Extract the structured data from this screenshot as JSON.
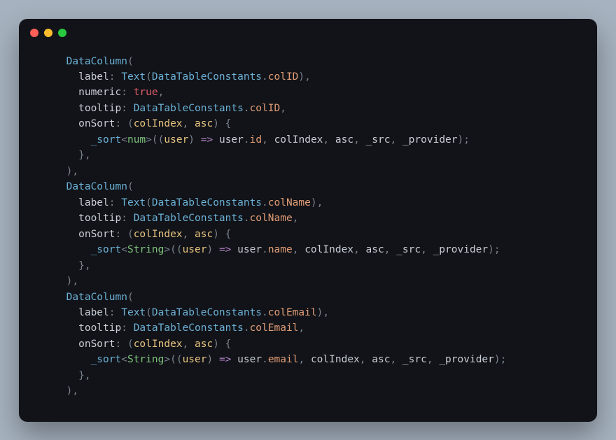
{
  "lang": "dart",
  "titlebar": {
    "close": "close",
    "minimize": "minimize",
    "zoom": "zoom"
  },
  "indent": {
    "d1": "     ",
    "d2": "       ",
    "d3": "         "
  },
  "tokens": {
    "DataColumn": "DataColumn",
    "Text": "Text",
    "DataTableConstants": "DataTableConstants",
    "label": "label",
    "numeric": "numeric",
    "tooltip": "tooltip",
    "onSort": "onSort",
    "true": "true",
    "colID": "colID",
    "colName": "colName",
    "colEmail": "colEmail",
    "colIndex": "colIndex",
    "asc": "asc",
    "_sort": "_sort",
    "num": "num",
    "String": "String",
    "arrow": "=>",
    "user": "user",
    "id": "id",
    "name": "name",
    "email": "email",
    "_src": "_src",
    "_provider": "_provider"
  },
  "punct": {
    "open": "(",
    "close": ")",
    "comma": ",",
    "colon": ":",
    "space": " ",
    "lt": "<",
    "gt": ">",
    "dot": ".",
    "lbrace": "{",
    "rbrace": "}",
    "semi": ";",
    "dparen_open": "((",
    "close_comma": "),",
    "rbrace_comma": "},",
    "close_brace": ") {"
  }
}
